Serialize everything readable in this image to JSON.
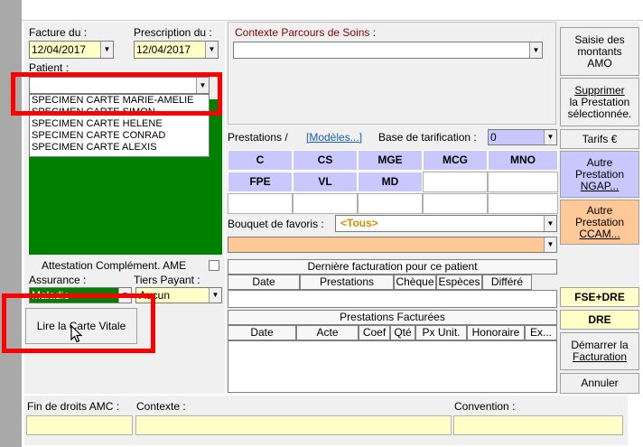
{
  "facture": {
    "label": "Facture du :",
    "date": "12/04/2017"
  },
  "prescription": {
    "label": "Prescription du :",
    "date": "12/04/2017"
  },
  "patient": {
    "label": "Patient :",
    "input_value": "",
    "options": [
      "SPECIMEN CARTE MARIE-AMELIE",
      "SPECIMEN CARTE SIMON",
      "SPECIMEN CARTE HELENE",
      "SPECIMEN CARTE CONRAD",
      "SPECIMEN CARTE ALEXIS"
    ]
  },
  "attestation_label": "Attestation Complément. AME",
  "assurance": {
    "label": "Assurance :",
    "value": "Maladie"
  },
  "tiers_payant": {
    "label": "Tiers Payant :",
    "value": "Aucun"
  },
  "lire_carte_vitale": "Lire la Carte Vitale",
  "contexte_parcours": {
    "label": "Contexte Parcours de Soins  :",
    "value": ""
  },
  "prestations": {
    "label": "Prestations /",
    "modeles_link": "[Modèles...]"
  },
  "base_tarification": {
    "label": "Base de tarification :",
    "value": "0"
  },
  "acts_row1": [
    "C",
    "CS",
    "MGE",
    "MCG",
    "MNO"
  ],
  "acts_row2": [
    "FPE",
    "VL",
    "MD",
    "",
    ""
  ],
  "acts_row3": [
    "",
    "",
    "",
    "",
    ""
  ],
  "bouquet": {
    "label": "Bouquet de favoris :",
    "value": "<Tous>"
  },
  "derniere_facturation": {
    "title": "Dernière facturation pour ce patient",
    "columns": [
      "Date",
      "Prestations",
      "Chèque",
      "Espèces",
      "Différé"
    ]
  },
  "prestations_facturees": {
    "title": "Prestations Facturées",
    "columns": [
      "Date",
      "Acte",
      "Coef",
      "Qté",
      "Px Unit.",
      "Honoraire",
      "Ex..."
    ]
  },
  "right_buttons": {
    "saisie": "Saisie des montants AMO",
    "supprimer_1": "Supprimer",
    "supprimer_2": "la Prestation sélectionnée.",
    "tarifs": "Tarifs €",
    "autre_ngap_1": "Autre Prestation",
    "autre_ngap_2": "NGAP...",
    "autre_ccam_1": "Autre Prestation",
    "autre_ccam_2": "CCAM...",
    "fse_dre": "FSE+DRE",
    "dre": "DRE",
    "demarrer_1": "Démarrer la",
    "demarrer_2": "Facturation",
    "annuler": "Annuler"
  },
  "bottom": {
    "fin_droits_label": "Fin de droits AMC :",
    "contexte_label": "Contexte :",
    "convention_label": "Convention :"
  },
  "colors": {
    "green_panel": "#008000",
    "act_blue": "#c8c8ff",
    "favoris_orange": "#ffc896",
    "input_yellow": "#ffffc8",
    "annotation_red": "#ff0000"
  }
}
